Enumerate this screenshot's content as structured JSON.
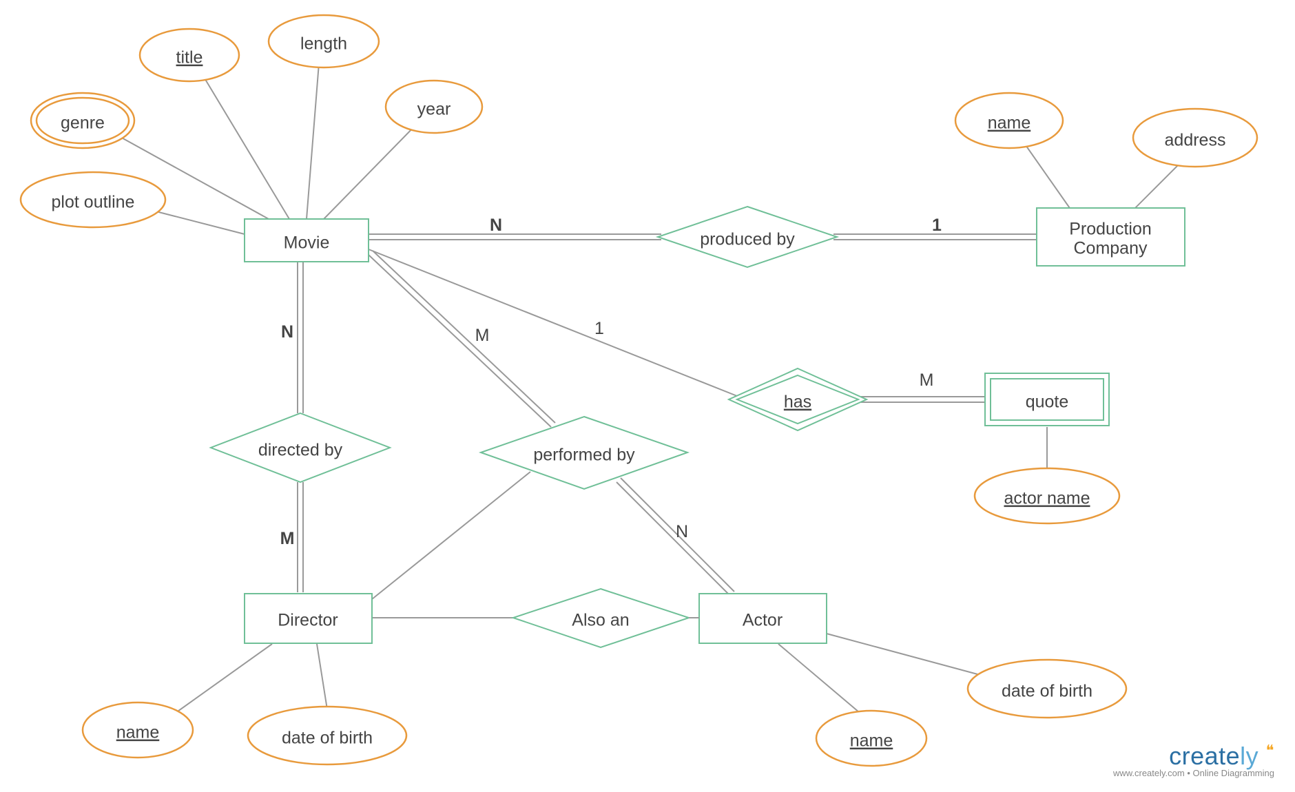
{
  "entities": {
    "movie": "Movie",
    "production_company_l1": "Production",
    "production_company_l2": "Company",
    "director": "Director",
    "actor": "Actor",
    "quote": "quote"
  },
  "relationships": {
    "produced_by": "produced by",
    "directed_by": "directed by",
    "performed_by": "performed by",
    "also_an": "Also an",
    "has": "has"
  },
  "attributes": {
    "movie": {
      "genre": "genre",
      "title": "title",
      "length": "length",
      "year": "year",
      "plot_outline": "plot outline"
    },
    "production_company": {
      "name": "name",
      "address": "address"
    },
    "director": {
      "name": "name",
      "dob": "date of birth"
    },
    "actor": {
      "name": "name",
      "dob": "date of birth"
    },
    "quote": {
      "actor_name": "actor name"
    }
  },
  "cardinalities": {
    "movie_produced_by": "N",
    "production_company_produced_by": "1",
    "movie_directed_by": "N",
    "director_directed_by": "M",
    "movie_performed_by": "M",
    "actor_performed_by": "N",
    "movie_has": "1",
    "quote_has": "M"
  },
  "watermark": {
    "brand_part1": "create",
    "brand_part2": "ly",
    "subtitle": "www.creately.com • Online Diagramming"
  },
  "colors": {
    "entity_stroke": "#6fbf97",
    "attribute_stroke": "#e89a3c",
    "line": "#999999",
    "text": "#444444"
  }
}
